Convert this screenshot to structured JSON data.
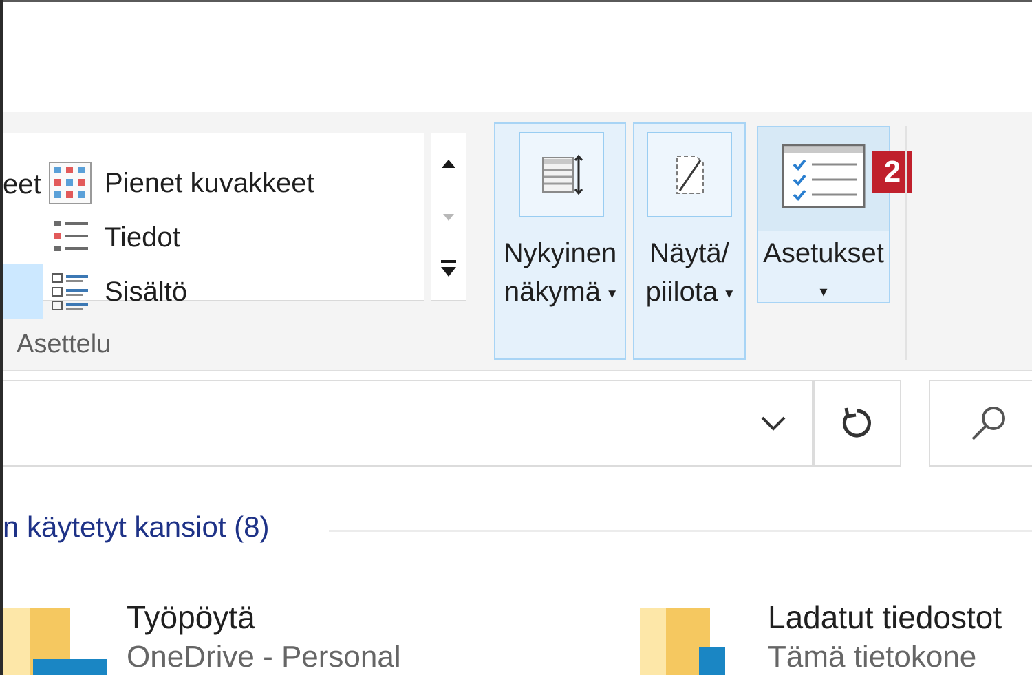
{
  "ribbon": {
    "layout_group": {
      "cut_label": "eet",
      "items": [
        {
          "label": "Pienet kuvakkeet",
          "icon": "small-icons-icon"
        },
        {
          "label": "Tiedot",
          "icon": "details-icon"
        },
        {
          "label": "Sisältö",
          "icon": "content-icon"
        }
      ],
      "group_label": "Asettelu"
    },
    "current_view": {
      "line1": "Nykyinen",
      "line2": "näkymä",
      "caret": "▾"
    },
    "show_hide": {
      "line1": "Näytä/",
      "line2": "piilota",
      "caret": "▾"
    },
    "options": {
      "label": "Asetukset",
      "caret": "▾",
      "badge": "2"
    }
  },
  "section": {
    "title": "n käytetyt kansiot (8)"
  },
  "folders": [
    {
      "name": "Työpöytä",
      "location": "OneDrive - Personal"
    },
    {
      "name": "Ladatut tiedostot",
      "location": "Tämä tietokone"
    }
  ],
  "colors": {
    "accent": "#cce8ff",
    "badge": "#c0202c",
    "section_title": "#1e3287"
  }
}
